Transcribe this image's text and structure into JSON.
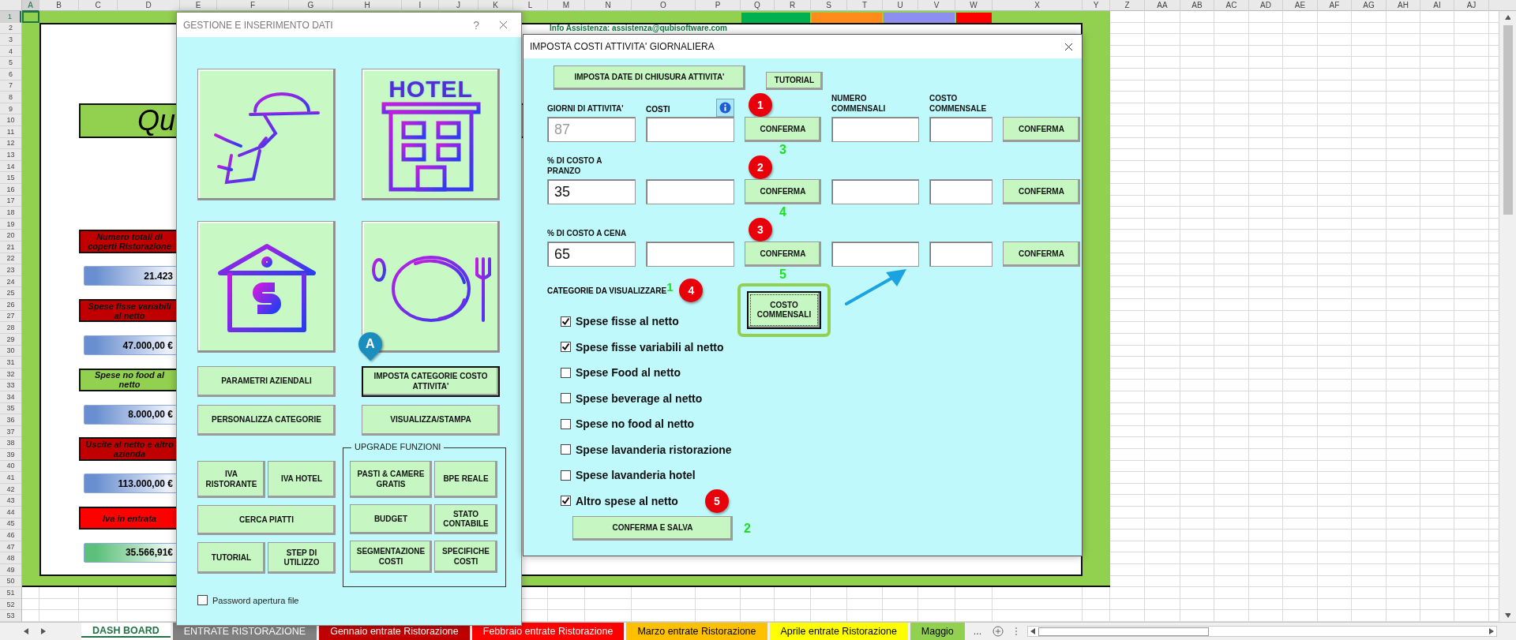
{
  "sheet": {
    "columns": [
      {
        "label": "A",
        "selected": true
      },
      {
        "label": "B",
        "selected": false
      },
      {
        "label": "C",
        "selected": false
      },
      {
        "label": "D",
        "selected": false
      },
      {
        "label": "E",
        "selected": false
      },
      {
        "label": "F",
        "selected": false
      },
      {
        "label": "G",
        "selected": false
      },
      {
        "label": "H",
        "selected": false
      },
      {
        "label": "I",
        "selected": false
      },
      {
        "label": "J",
        "selected": false
      },
      {
        "label": "K",
        "selected": false
      },
      {
        "label": "L",
        "selected": false
      },
      {
        "label": "M",
        "selected": false
      },
      {
        "label": "N",
        "selected": false
      },
      {
        "label": "O",
        "selected": false
      },
      {
        "label": "P",
        "selected": false
      },
      {
        "label": "Q",
        "selected": false
      },
      {
        "label": "R",
        "selected": false
      },
      {
        "label": "S",
        "selected": false
      },
      {
        "label": "T",
        "selected": false
      },
      {
        "label": "U",
        "selected": false
      },
      {
        "label": "V",
        "selected": false
      },
      {
        "label": "W",
        "selected": false
      },
      {
        "label": "X",
        "selected": false
      },
      {
        "label": "Y",
        "selected": false
      },
      {
        "label": "Z",
        "selected": false
      },
      {
        "label": "AA",
        "selected": false
      },
      {
        "label": "AB",
        "selected": false
      },
      {
        "label": "AC",
        "selected": false
      },
      {
        "label": "AD",
        "selected": false
      },
      {
        "label": "AE",
        "selected": false
      },
      {
        "label": "AF",
        "selected": false
      },
      {
        "label": "AG",
        "selected": false
      },
      {
        "label": "AH",
        "selected": false
      },
      {
        "label": "AI",
        "selected": false
      },
      {
        "label": "AJ",
        "selected": false
      }
    ],
    "rows": [
      {
        "label": "1",
        "selected": true
      },
      {
        "label": "2",
        "selected": false
      },
      {
        "label": "3",
        "selected": false
      },
      {
        "label": "4",
        "selected": false
      },
      {
        "label": "5",
        "selected": false
      },
      {
        "label": "6",
        "selected": false
      },
      {
        "label": "7",
        "selected": false
      },
      {
        "label": "8",
        "selected": false
      },
      {
        "label": "9",
        "selected": false
      },
      {
        "label": "10",
        "selected": false
      },
      {
        "label": "11",
        "selected": false
      },
      {
        "label": "12",
        "selected": false
      },
      {
        "label": "13",
        "selected": false
      },
      {
        "label": "14",
        "selected": false
      },
      {
        "label": "15",
        "selected": false
      },
      {
        "label": "16",
        "selected": false
      },
      {
        "label": "17",
        "selected": false
      },
      {
        "label": "18",
        "selected": false
      },
      {
        "label": "19",
        "selected": false
      },
      {
        "label": "20",
        "selected": false
      },
      {
        "label": "21",
        "selected": false
      },
      {
        "label": "22",
        "selected": false
      },
      {
        "label": "23",
        "selected": false
      },
      {
        "label": "24",
        "selected": false
      },
      {
        "label": "25",
        "selected": false
      },
      {
        "label": "26",
        "selected": false
      },
      {
        "label": "27",
        "selected": false
      },
      {
        "label": "28",
        "selected": false
      },
      {
        "label": "29",
        "selected": false
      },
      {
        "label": "30",
        "selected": false
      },
      {
        "label": "31",
        "selected": false
      },
      {
        "label": "32",
        "selected": false
      },
      {
        "label": "33",
        "selected": false
      },
      {
        "label": "34",
        "selected": false
      },
      {
        "label": "35",
        "selected": false
      },
      {
        "label": "36",
        "selected": false
      },
      {
        "label": "37",
        "selected": false
      },
      {
        "label": "38",
        "selected": false
      },
      {
        "label": "39",
        "selected": false
      },
      {
        "label": "40",
        "selected": false
      },
      {
        "label": "41",
        "selected": false
      },
      {
        "label": "42",
        "selected": false
      },
      {
        "label": "43",
        "selected": false
      },
      {
        "label": "44",
        "selected": false
      },
      {
        "label": "45",
        "selected": false
      },
      {
        "label": "46",
        "selected": false
      },
      {
        "label": "47",
        "selected": false
      },
      {
        "label": "48",
        "selected": false
      },
      {
        "label": "49",
        "selected": false
      },
      {
        "label": "50",
        "selected": false
      },
      {
        "label": "51",
        "selected": false
      },
      {
        "label": "52",
        "selected": false
      },
      {
        "label": "53",
        "selected": false
      }
    ],
    "title": "Qu",
    "info": "Info Assistenza: assistenza@qubisoftware.com",
    "header_blocks": [
      {
        "color": "#00b050"
      },
      {
        "color": "#ff8c1a"
      },
      {
        "color": "#8e8ef0"
      },
      {
        "color": "#ff0000"
      }
    ],
    "summary": [
      {
        "kind": "label",
        "text": "Numero totali di coperti Ristorazione",
        "color": "#c00000"
      },
      {
        "kind": "value",
        "text": "21.423",
        "color": "#6a8fd0"
      },
      {
        "kind": "label",
        "text": "Spese fisse variabili al netto",
        "color": "#c00000"
      },
      {
        "kind": "value",
        "text": "47.000,00 €",
        "color": "#6a8fd0"
      },
      {
        "kind": "label",
        "text": "Spese no food al netto",
        "color": "#92d050"
      },
      {
        "kind": "value",
        "text": "8.000,00 €",
        "color": "#6a8fd0"
      },
      {
        "kind": "label",
        "text": "Uscite al netto e altro azienda",
        "color": "#c00000"
      },
      {
        "kind": "value",
        "text": "113.000,00 €",
        "color": "#6a8fd0"
      },
      {
        "kind": "label",
        "text": "Iva in entrata",
        "color": "#ff0000"
      },
      {
        "kind": "value",
        "text": "35.566,91€",
        "color": "#5cc07a"
      }
    ]
  },
  "dialog_main": {
    "title": "GESTIONE E INSERIMENTO DATI",
    "help": "?",
    "tiles": [
      {
        "kind": "waiter"
      },
      {
        "kind": "hotel",
        "sign": "HOTEL"
      },
      {
        "kind": "house"
      },
      {
        "kind": "plate"
      }
    ],
    "buttons": [
      {
        "label": "PARAMETRI AZIENDALI",
        "selected": false
      },
      {
        "label": "IMPOSTA CATEGORIE COSTO ATTIVITA'",
        "selected": true
      },
      {
        "label": "PERSONALIZZA CATEGORIE",
        "selected": false
      },
      {
        "label": "VISUALIZZA/STAMPA",
        "selected": false
      }
    ],
    "left_group": [
      {
        "buttons": [
          "IVA RISTORANTE",
          "IVA HOTEL"
        ]
      },
      {
        "buttons": [
          "CERCA PIATTI"
        ]
      },
      {
        "buttons": [
          "TUTORIAL",
          "STEP DI UTILIZZO"
        ]
      }
    ],
    "upgrade": {
      "legend": "UPGRADE FUNZIONI",
      "rows": [
        {
          "buttons": [
            "PASTI & CAMERE GRATIS",
            "BPE REALE"
          ]
        },
        {
          "buttons": [
            "BUDGET",
            "STATO CONTABILE"
          ]
        },
        {
          "buttons": [
            "SEGMENTAZIONE COSTI",
            "SPECIFICHE COSTI"
          ]
        }
      ]
    },
    "password": {
      "label": "Password apertura file",
      "checked": false
    },
    "pin": "A"
  },
  "dialog_costs": {
    "title": "IMPOSTA COSTI ATTIVITA' GIORNALIERA",
    "top_buttons": [
      "IMPOSTA DATE DI CHIUSURA ATTIVITA'",
      "TUTORIAL"
    ],
    "headers": [
      "COSTI",
      "NUMERO COMMENSALI",
      "COSTO COMMENSALE"
    ],
    "rows": [
      {
        "label": "GIORNI DI ATTIVITA'",
        "value": "87",
        "disabled": true,
        "badge": "1",
        "step": "3",
        "confirm": [
          "CONFERMA",
          "CONFERMA"
        ]
      },
      {
        "label": "% DI COSTO A PRANZO",
        "value": "35",
        "disabled": false,
        "badge": "2",
        "step": "4",
        "confirm": [
          "CONFERMA",
          "CONFERMA"
        ]
      },
      {
        "label": "% DI COSTO A CENA",
        "value": "65",
        "disabled": false,
        "badge": "3",
        "step": "5",
        "confirm": [
          "CONFERMA",
          "CONFERMA"
        ]
      }
    ],
    "categories": {
      "label": "CATEGORIE DA VISUALIZZARE",
      "note": "1",
      "badge": "4",
      "items": [
        {
          "label": "Spese fisse al netto",
          "checked": true
        },
        {
          "label": "Spese fisse variabili al netto",
          "checked": true
        },
        {
          "label": "Spese Food al netto",
          "checked": false
        },
        {
          "label": "Spese beverage al netto",
          "checked": false
        },
        {
          "label": "Spese no food al netto",
          "checked": false
        },
        {
          "label": "Spese lavanderia ristorazione",
          "checked": false
        },
        {
          "label": "Spese lavanderia hotel",
          "checked": false
        },
        {
          "label": "Altro spese al netto",
          "checked": true,
          "badge": "5"
        }
      ]
    },
    "highlight_button": "COSTO COMMENSALI",
    "save": {
      "label": "CONFERMA E SALVA",
      "step": "2"
    }
  },
  "sheet_tabs": {
    "tabs": [
      {
        "label": "DASH BOARD",
        "color": "#ffffff",
        "selected": true
      },
      {
        "label": "ENTRATE RISTORAZIONE",
        "color": "#808080",
        "selected": false
      },
      {
        "label": "Gennaio entrate Ristorazione",
        "color": "#c00000",
        "selected": false
      },
      {
        "label": "Febbraio entrate Ristorazione",
        "color": "#ff0000",
        "selected": false
      },
      {
        "label": "Marzo entrate Ristorazione",
        "color": "#ffc000",
        "selected": false
      },
      {
        "label": "Aprile entrate Ristorazione",
        "color": "#ffff00",
        "selected": false
      },
      {
        "label": "Maggio",
        "color": "#92d050",
        "selected": false
      }
    ],
    "more": "..."
  }
}
